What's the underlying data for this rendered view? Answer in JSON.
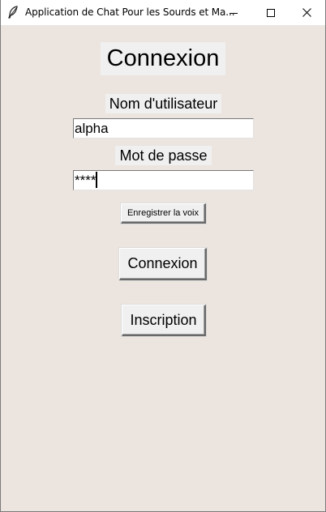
{
  "window": {
    "title": "Application de Chat Pour les Sourds et Ma..."
  },
  "form": {
    "heading": "Connexion",
    "username_label": "Nom d'utilisateur",
    "username_value": "alpha",
    "password_label": "Mot de passe",
    "password_value": "****",
    "voice_button": "Enregistrer la voix",
    "login_button": "Connexion",
    "register_button": "Inscription"
  },
  "icons": {
    "app": "feather-icon",
    "minimize": "minimize-icon",
    "maximize": "maximize-icon",
    "close": "close-icon"
  },
  "colors": {
    "background": "#ece5df",
    "widget": "#f0f0f0",
    "titlebar": "#ffffff"
  }
}
